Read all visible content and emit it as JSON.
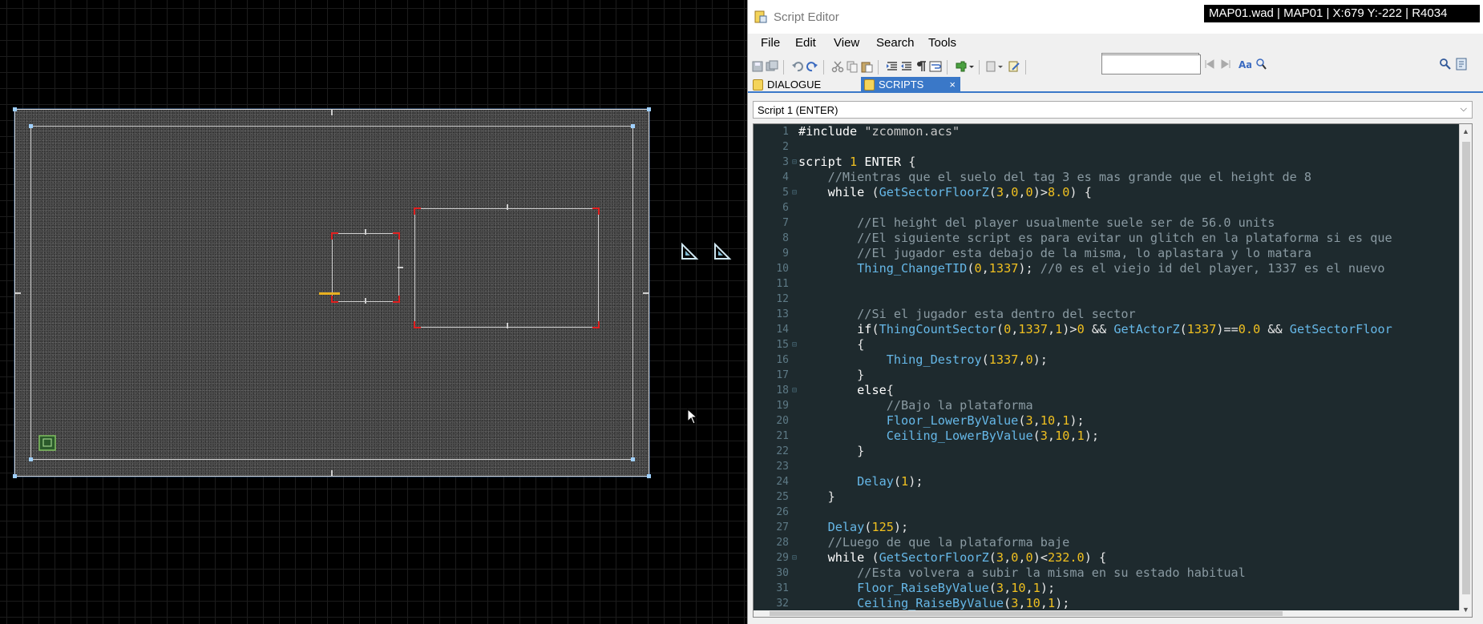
{
  "status_bar": {
    "text": "MAP01.wad | MAP01 | X:679 Y:-222 | R4034"
  },
  "editor": {
    "title": "Script Editor",
    "menu": [
      "File",
      "Edit",
      "View",
      "Search",
      "Tools"
    ],
    "search": {
      "value": ""
    },
    "tabs": [
      {
        "label": "DIALOGUE",
        "active": false
      },
      {
        "label": "SCRIPTS",
        "active": true,
        "close": "×"
      }
    ],
    "script_selector": {
      "value": "Script 1 (ENTER)"
    }
  },
  "code_lines": [
    {
      "n": "1",
      "fold": "",
      "html": "<span class='c-kw'>#include</span> <span class='c-str'>\"zcommon.acs\"</span>"
    },
    {
      "n": "2",
      "fold": "",
      "html": ""
    },
    {
      "n": "3",
      "fold": "⊟",
      "html": "<span class='c-kw'>script</span> <span class='c-num'>1</span> <span class='c-kw'>ENTER</span> {"
    },
    {
      "n": "4",
      "fold": "",
      "html": "    <span class='c-cmt'>//Mientras que el suelo del tag 3 es mas grande que el height de 8</span>"
    },
    {
      "n": "5",
      "fold": "⊟",
      "html": "    <span class='c-kw'>while</span> (<span class='c-fn'>GetSectorFloorZ</span>(<span class='c-num'>3</span>,<span class='c-num'>0</span>,<span class='c-num'>0</span>)><span class='c-num'>8.0</span>) {"
    },
    {
      "n": "6",
      "fold": "",
      "html": ""
    },
    {
      "n": "7",
      "fold": "",
      "html": "        <span class='c-cmt'>//El height del player usualmente suele ser de 56.0 units</span>"
    },
    {
      "n": "8",
      "fold": "",
      "html": "        <span class='c-cmt'>//El siguiente script es para evitar un glitch en la plataforma si es que</span>"
    },
    {
      "n": "9",
      "fold": "",
      "html": "        <span class='c-cmt'>//El jugador esta debajo de la misma, lo aplastara y lo matara</span>"
    },
    {
      "n": "10",
      "fold": "",
      "html": "        <span class='c-fn'>Thing_ChangeTID</span>(<span class='c-num'>0</span>,<span class='c-num'>1337</span>); <span class='c-cmt'>//0 es el viejo id del player, 1337 es el nuevo</span>"
    },
    {
      "n": "11",
      "fold": "",
      "html": ""
    },
    {
      "n": "12",
      "fold": "",
      "html": ""
    },
    {
      "n": "13",
      "fold": "",
      "html": "        <span class='c-cmt'>//Si el jugador esta dentro del sector</span>"
    },
    {
      "n": "14",
      "fold": "",
      "html": "        <span class='c-kw'>if</span>(<span class='c-fn'>ThingCountSector</span>(<span class='c-num'>0</span>,<span class='c-num'>1337</span>,<span class='c-num'>1</span>)><span class='c-num'>0</span> && <span class='c-fn'>GetActorZ</span>(<span class='c-num'>1337</span>)==<span class='c-num'>0.0</span> && <span class='c-fn'>GetSectorFloor</span>"
    },
    {
      "n": "15",
      "fold": "⊟",
      "html": "        {"
    },
    {
      "n": "16",
      "fold": "",
      "html": "            <span class='c-fn'>Thing_Destroy</span>(<span class='c-num'>1337</span>,<span class='c-num'>0</span>);"
    },
    {
      "n": "17",
      "fold": "",
      "html": "        }"
    },
    {
      "n": "18",
      "fold": "⊟",
      "html": "        <span class='c-kw'>else</span>{"
    },
    {
      "n": "19",
      "fold": "",
      "html": "            <span class='c-cmt'>//Bajo la plataforma</span>"
    },
    {
      "n": "20",
      "fold": "",
      "html": "            <span class='c-fn'>Floor_LowerByValue</span>(<span class='c-num'>3</span>,<span class='c-num'>10</span>,<span class='c-num'>1</span>);"
    },
    {
      "n": "21",
      "fold": "",
      "html": "            <span class='c-fn'>Ceiling_LowerByValue</span>(<span class='c-num'>3</span>,<span class='c-num'>10</span>,<span class='c-num'>1</span>);"
    },
    {
      "n": "22",
      "fold": "",
      "html": "        }"
    },
    {
      "n": "23",
      "fold": "",
      "html": ""
    },
    {
      "n": "24",
      "fold": "",
      "html": "        <span class='c-fn'>Delay</span>(<span class='c-num'>1</span>);"
    },
    {
      "n": "25",
      "fold": "",
      "html": "    }"
    },
    {
      "n": "26",
      "fold": "",
      "html": ""
    },
    {
      "n": "27",
      "fold": "",
      "html": "    <span class='c-fn'>Delay</span>(<span class='c-num'>125</span>);"
    },
    {
      "n": "28",
      "fold": "",
      "html": "    <span class='c-cmt'>//Luego de que la plataforma baje</span>"
    },
    {
      "n": "29",
      "fold": "⊟",
      "html": "    <span class='c-kw'>while</span> (<span class='c-fn'>GetSectorFloorZ</span>(<span class='c-num'>3</span>,<span class='c-num'>0</span>,<span class='c-num'>0</span>)<<span class='c-num'>232.0</span>) {"
    },
    {
      "n": "30",
      "fold": "",
      "html": "        <span class='c-cmt'>//Esta volvera a subir la misma en su estado habitual</span>"
    },
    {
      "n": "31",
      "fold": "",
      "html": "        <span class='c-fn'>Floor_RaiseByValue</span>(<span class='c-num'>3</span>,<span class='c-num'>10</span>,<span class='c-num'>1</span>);"
    },
    {
      "n": "32",
      "fold": "",
      "html": "        <span class='c-fn'>Ceiling_RaiseByValue</span>(<span class='c-num'>3</span>,<span class='c-num'>10</span>,<span class='c-num'>1</span>);"
    }
  ]
}
